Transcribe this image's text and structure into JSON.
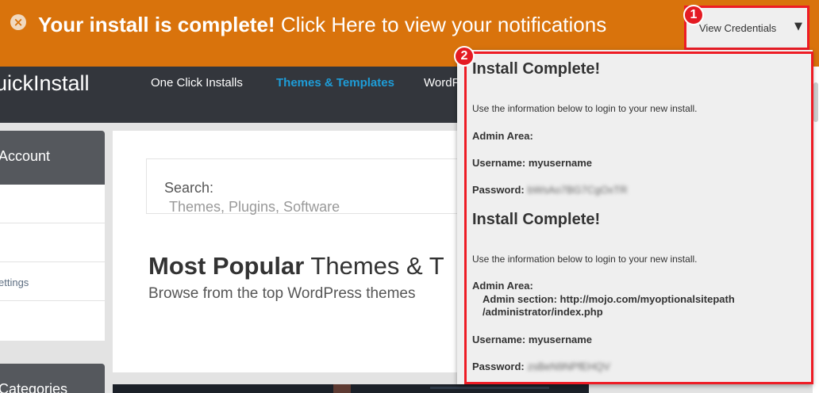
{
  "notification": {
    "close_glyph": "×",
    "bold": "Your install is complete!",
    "text": " Click Here to view your notifications",
    "button_label": "View Credentials",
    "dropdown_arrow": "▼",
    "accent": "#d9730c"
  },
  "badges": {
    "one": "1",
    "two": "2",
    "color": "#e41b23"
  },
  "header": {
    "brand": "uickInstall",
    "nav": [
      "One Click Installs",
      "Themes & Templates",
      "WordP"
    ],
    "active_color": "#1e9dd8"
  },
  "sidebar": {
    "section1": "Account",
    "items": [
      "",
      "",
      "ettings",
      ""
    ],
    "section2": "Categories"
  },
  "main": {
    "search_label": "Search:",
    "search_placeholder": "Themes, Plugins, Software",
    "title_bold": "Most Popular",
    "title_rest": " Themes & T",
    "subtitle": "Browse from the top WordPress themes"
  },
  "credentials": [
    {
      "heading": "Install Complete!",
      "intro": "Use the information below to login to your new install.",
      "admin_label": "Admin Area:",
      "admin_value": "",
      "username_label": "Username:",
      "username": "myusername",
      "password_label": "Password:",
      "password": "bWsAo7BG7CgOxTR"
    },
    {
      "heading": "Install Complete!",
      "intro": "Use the information below to login to your new install.",
      "admin_label": "Admin Area:",
      "admin_value": "Admin section: http://mojo.com/myoptionalsitepath",
      "admin_value_line2": "/administrator/index.php",
      "username_label": "Username:",
      "username": "myusername",
      "password_label": "Password:",
      "password": "zsBeN9NPfEHQV"
    }
  ]
}
